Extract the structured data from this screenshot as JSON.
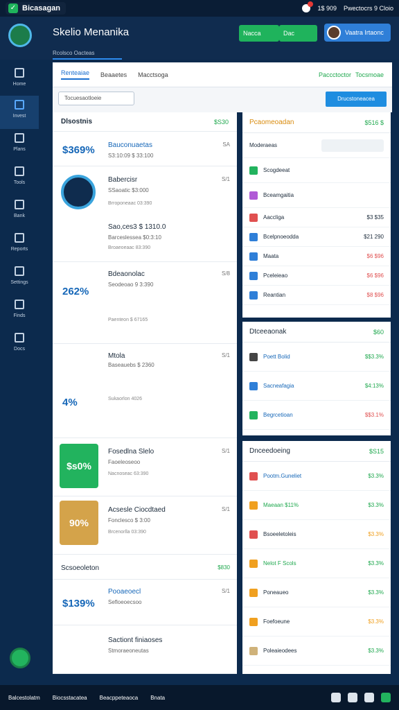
{
  "topbar": {
    "brand": "Bicasagan",
    "count": "1$ 909",
    "user": "Pwectocrs 9 Cloio"
  },
  "header": {
    "title": "Skelio Menanika",
    "subtab": "Rcolsco Oacteas",
    "btn1": "Nacca",
    "btn2": "Dac",
    "profile_name": "Vaatra Irtaonc"
  },
  "sidebar": [
    "Home",
    "Invest",
    "Plans",
    "Tools",
    "Bank",
    "Reports",
    "Settings",
    "Finds",
    "Docs"
  ],
  "main": {
    "tabs": [
      "Renteaiae",
      "Beaaetes",
      "Macctsoga"
    ],
    "right_label": "Paccctoctor",
    "right_label2": "Tocsmoae",
    "filter": "Tocuesaotloeie",
    "filter_btn": "Drucstoneacea"
  },
  "left": {
    "header": "Dlsostnis",
    "header_amt": "$S30",
    "rows": [
      {
        "pct": "$369%",
        "name": "Bauconuaetas",
        "meta": "S3:10:09 $ 33:100",
        "tag": "SA"
      },
      {
        "name": "Babercisr",
        "meta": "SSaoatic $3:000",
        "bar": "Brroponeaac 03:390",
        "tag": "S/1"
      },
      {
        "name": "Sao,ces3 $ 1310.0",
        "meta": "Barceslessea $0:3:10",
        "bar": "Broaeoeaac 83:390",
        "tag": ""
      },
      {
        "pct": "262%",
        "name": "Bdeaonolac",
        "meta": "Seodeoao 9 3:390",
        "bar": "Paenteon $ 67165",
        "tag": "S/8"
      },
      {
        "pct": "4%",
        "name": "Mtola",
        "meta": "Baseauebs $ 2360",
        "bar": "Sukaorlon 4026",
        "tag": "S/1"
      },
      {
        "name": "Fosedlna Slelo",
        "meta": "Faoeleoseoo",
        "bar": "Nacnoseac 63:390",
        "tag": "S/1",
        "tile": "$s0%"
      },
      {
        "name": "Acsesle Ciocdtaed",
        "meta": "Fonclesco $ 3:00",
        "bar": "Brcenorlla 03:390",
        "tag": "S/1",
        "tile": "90%"
      }
    ],
    "section2": "Scsoeoleton",
    "section2_amt": "$830",
    "rows2": [
      {
        "pct": "$139%",
        "name": "Pooaeoecl",
        "meta": "Sefloeoecsoo",
        "tag": "S/1"
      },
      {
        "name": "Sactiont finiaoses",
        "meta": "Stmoraeoneutas",
        "tag": ""
      }
    ]
  },
  "right1": {
    "header": "Pcaomeoadan",
    "header_amt": "$516 $",
    "search": "Moderaeas",
    "rows": [
      {
        "label": "Scogdeeat",
        "val": ""
      },
      {
        "label": "Bceamgaitia",
        "val": ""
      },
      {
        "label": "Aaccliga",
        "val": "$3 $35"
      },
      {
        "label": "Bcelpnoeodda",
        "val": "$21 290"
      },
      {
        "label": "Maata",
        "val": "$6 $96"
      },
      {
        "label": "Pceleieao",
        "val": "$6 $96"
      },
      {
        "label": "Reantian",
        "val": "$8 $96"
      }
    ]
  },
  "right2": {
    "header": "Dtceeaonak",
    "header_amt": "$60",
    "rows": [
      {
        "label": "Poett Bolid",
        "val": "$$3.3%"
      },
      {
        "label": "Sacneafagia",
        "val": "$4:13%"
      },
      {
        "label": "Begrcetioan",
        "val": "$$3.1%"
      }
    ]
  },
  "right3": {
    "header": "Dnceedoeing",
    "header_amt": "$S15",
    "rows": [
      {
        "label": "Pootm.Guneliet",
        "val": "$3.3%"
      },
      {
        "label": "Maeaan $11%",
        "val": "$3.3%"
      },
      {
        "label": "Bsoeeletoleis",
        "val": "$3.3%"
      },
      {
        "label": "Nelot F Scols",
        "val": "$3.3%"
      },
      {
        "label": "Poneaueo",
        "val": "$3.3%"
      },
      {
        "label": "Foefoeune",
        "val": "$3.3%"
      },
      {
        "label": "Poleaieodees",
        "val": "$3.3%"
      }
    ]
  },
  "bottom": [
    "Balcestolatm",
    "Biocsstacatea",
    "Beacppeteaoca",
    "Bnata"
  ]
}
